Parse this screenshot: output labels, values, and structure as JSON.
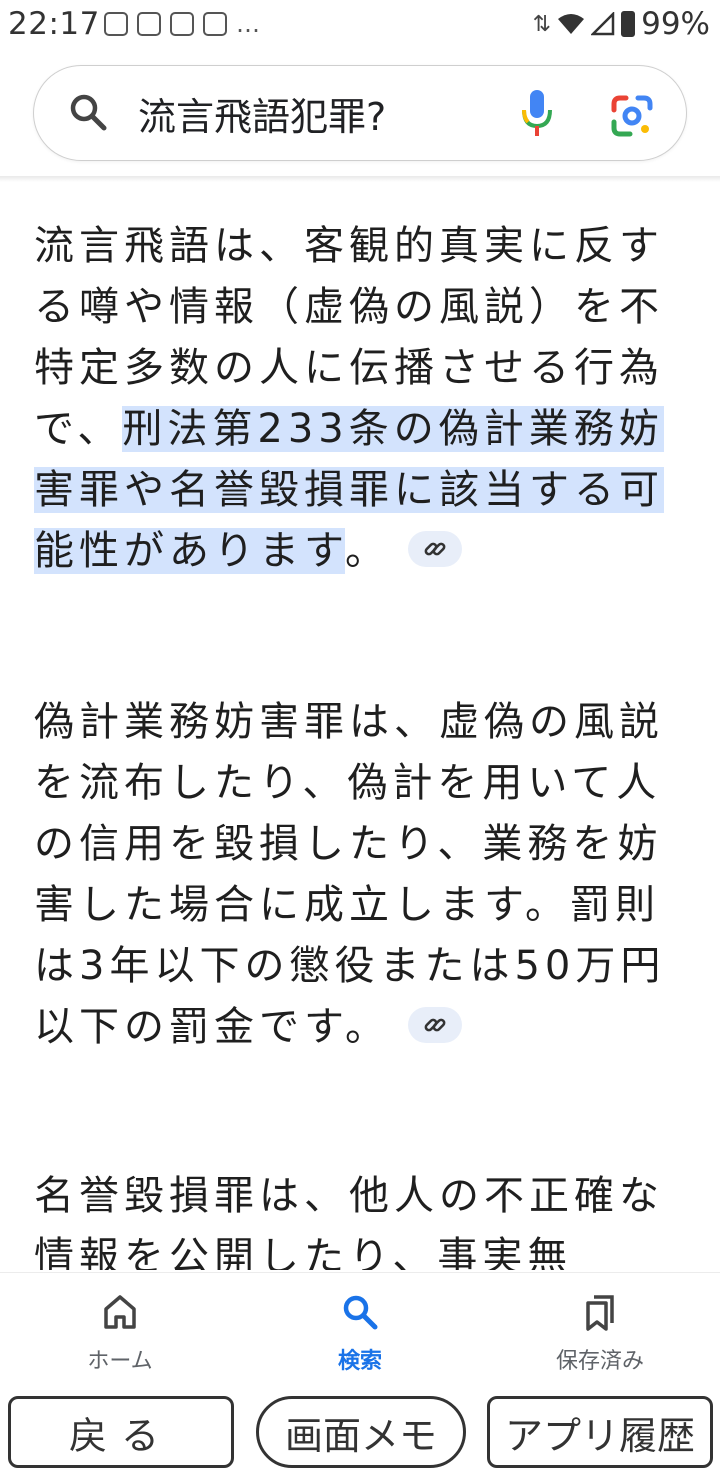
{
  "status_bar": {
    "time": "22:17",
    "more": "…",
    "battery_percent": "99%"
  },
  "search": {
    "query": "流言飛語犯罪?",
    "icons": [
      "search-icon",
      "mic-icon",
      "google-lens-icon"
    ]
  },
  "content": {
    "p1": {
      "before": "流言飛語は、客観的真実に反する噂や情報（虚偽の風説）を不特定多数の人に伝播させる行為で、",
      "highlight": "刑法第233条の偽計業務妨害罪や名誉毀損罪に該当する可能性があります",
      "after": "。"
    },
    "p2": "偽計業務妨害罪は、虚偽の風説を流布したり、偽計を用いて人の信用を毀損したり、業務を妨害した場合に成立します。罰則は3年以下の懲役または50万円以下の罰金です。",
    "p3": "名誉毀損罪は、他人の不正確な情報を公開したり、事実無"
  },
  "bottom_nav": {
    "home": "ホーム",
    "search": "検索",
    "saved": "保存済み",
    "active": "search"
  },
  "system_buttons": {
    "back": "戻る",
    "memo": "画面メモ",
    "apps": "アプリ履歴"
  },
  "colors": {
    "highlight": "#d3e3fd",
    "active_nav": "#1a73e8",
    "link_chip": "#e8eef9"
  }
}
